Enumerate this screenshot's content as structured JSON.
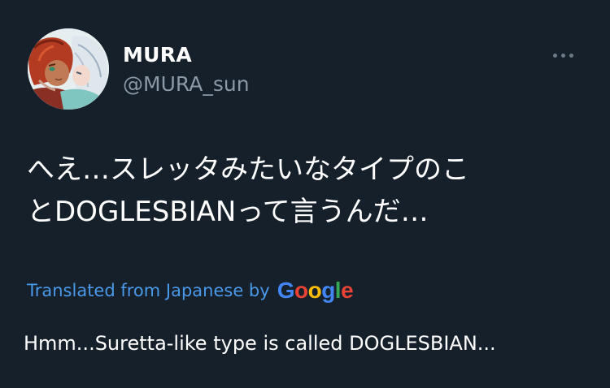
{
  "tweet": {
    "author": {
      "display_name": "MURA",
      "handle": "@MURA_sun",
      "avatar_icon": "avatar-illustration"
    },
    "more_icon": "ellipsis-icon",
    "text": "へえ…スレッタみたいなタイプのこ\nとDOGLESBIANって言うんだ…",
    "translation": {
      "label": "Translated from Japanese by",
      "provider": "Google",
      "provider_letters": [
        {
          "char": "G",
          "color": "#4285f4"
        },
        {
          "char": "o",
          "color": "#ea4335"
        },
        {
          "char": "o",
          "color": "#fbbc05"
        },
        {
          "char": "g",
          "color": "#4285f4"
        },
        {
          "char": "l",
          "color": "#34a853"
        },
        {
          "char": "e",
          "color": "#ea4335"
        }
      ],
      "text": "Hmm...Suretta-like type is called DOGLESBIAN..."
    }
  },
  "colors": {
    "background": "#15202b",
    "primary_text": "#ffffff",
    "secondary_text": "#8b98a5",
    "link": "#4a99e9"
  }
}
